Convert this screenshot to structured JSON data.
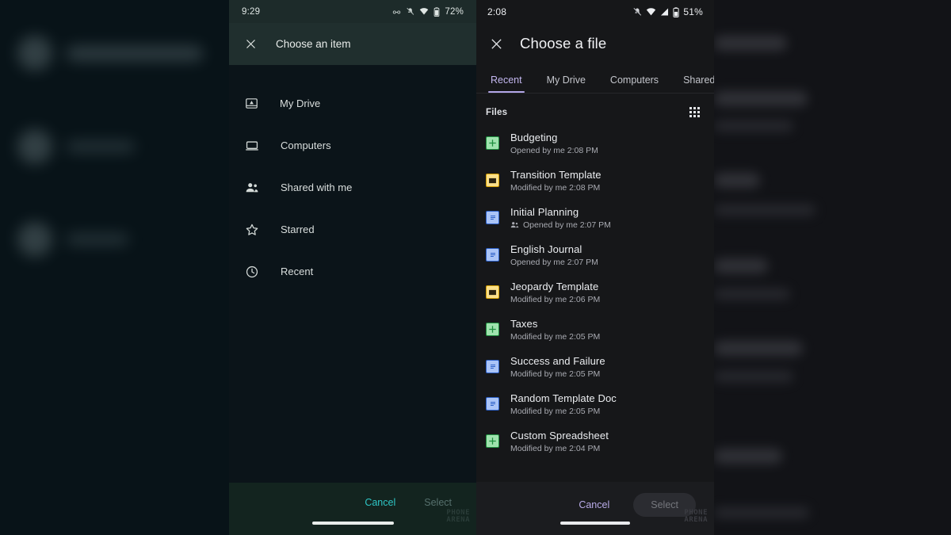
{
  "middle_phone": {
    "statusbar": {
      "time": "9:29",
      "battery": "72%",
      "icons": [
        "glasses-icon",
        "notifications-off-icon",
        "wifi-icon",
        "battery-icon"
      ]
    },
    "appbar": {
      "close_icon": "close-icon",
      "title": "Choose an item"
    },
    "nav_items": [
      {
        "label": "My Drive",
        "icon": "drive-icon"
      },
      {
        "label": "Computers",
        "icon": "laptop-icon"
      },
      {
        "label": "Shared with me",
        "icon": "people-icon"
      },
      {
        "label": "Starred",
        "icon": "star-icon"
      },
      {
        "label": "Recent",
        "icon": "clock-icon"
      }
    ],
    "bottombar": {
      "cancel": "Cancel",
      "select": "Select"
    },
    "watermark": {
      "line1": "PHONE",
      "line2": "ARENA"
    },
    "colors": {
      "background": "#0b1419",
      "appbar": "#202f2e",
      "accent": "#2ec6c6"
    }
  },
  "right_phone": {
    "statusbar": {
      "time": "2:08",
      "battery": "51%",
      "icons": [
        "notifications-off-icon",
        "wifi-icon",
        "signal-icon",
        "battery-icon"
      ]
    },
    "appbar": {
      "close_icon": "close-icon",
      "title": "Choose a file"
    },
    "tabs": [
      {
        "label": "Recent",
        "active": true
      },
      {
        "label": "My Drive",
        "active": false
      },
      {
        "label": "Computers",
        "active": false
      },
      {
        "label": "Shared with me",
        "active": false
      }
    ],
    "files_header": {
      "label": "Files",
      "view_toggle_icon": "grid-view-icon"
    },
    "files": [
      {
        "name": "Budgeting",
        "subtitle": "Opened by me 2:08 PM",
        "type": "sheets",
        "shared": false
      },
      {
        "name": "Transition Template",
        "subtitle": "Modified by me 2:08 PM",
        "type": "slides",
        "shared": false
      },
      {
        "name": "Initial Planning",
        "subtitle": "Opened by me 2:07 PM",
        "type": "docs",
        "shared": true
      },
      {
        "name": "English Journal",
        "subtitle": "Opened by me 2:07 PM",
        "type": "docs",
        "shared": false
      },
      {
        "name": "Jeopardy Template",
        "subtitle": "Modified by me 2:06 PM",
        "type": "slides",
        "shared": false
      },
      {
        "name": "Taxes",
        "subtitle": "Modified by me 2:05 PM",
        "type": "sheets",
        "shared": false
      },
      {
        "name": "Success and Failure",
        "subtitle": "Modified by me 2:05 PM",
        "type": "docs",
        "shared": false
      },
      {
        "name": "Random Template Doc",
        "subtitle": "Modified by me 2:05 PM",
        "type": "docs",
        "shared": false
      },
      {
        "name": "Custom Spreadsheet",
        "subtitle": "Modified by me 2:04 PM",
        "type": "sheets",
        "shared": false
      }
    ],
    "bottombar": {
      "cancel": "Cancel",
      "select": "Select"
    },
    "watermark": {
      "line1": "PHONE",
      "line2": "ARENA"
    },
    "colors": {
      "background": "#161719",
      "accent": "#b3a6e8",
      "bottombar": "#1b1c1f"
    }
  }
}
